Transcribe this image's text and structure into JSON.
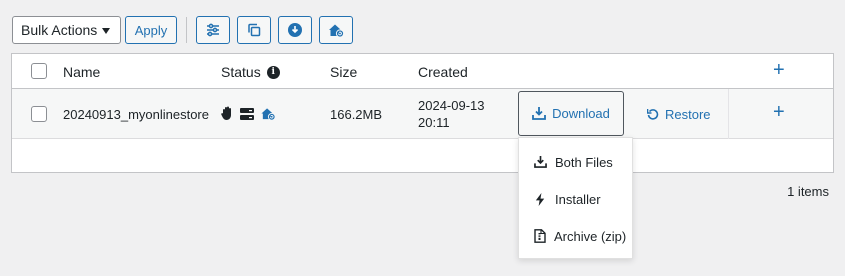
{
  "toolbar": {
    "bulk_actions": "Bulk Actions",
    "apply": "Apply"
  },
  "table": {
    "headers": {
      "name": "Name",
      "status": "Status",
      "size": "Size",
      "created": "Created"
    },
    "rows": [
      {
        "name": "20240913_myonlinestore",
        "status_icons": [
          "hand-icon",
          "server-icon",
          "home-restore-icon"
        ],
        "size": "166.2MB",
        "created_date": "2024-09-13",
        "created_time": "20:11",
        "download_label": "Download",
        "restore_label": "Restore"
      }
    ]
  },
  "dropdown": {
    "items": [
      "Both Files",
      "Installer",
      "Archive (zip)"
    ]
  },
  "footer": {
    "items_count": "1 items"
  },
  "colors": {
    "accent": "#2271b1",
    "text": "#1d2327",
    "background": "#f0f0f1"
  }
}
